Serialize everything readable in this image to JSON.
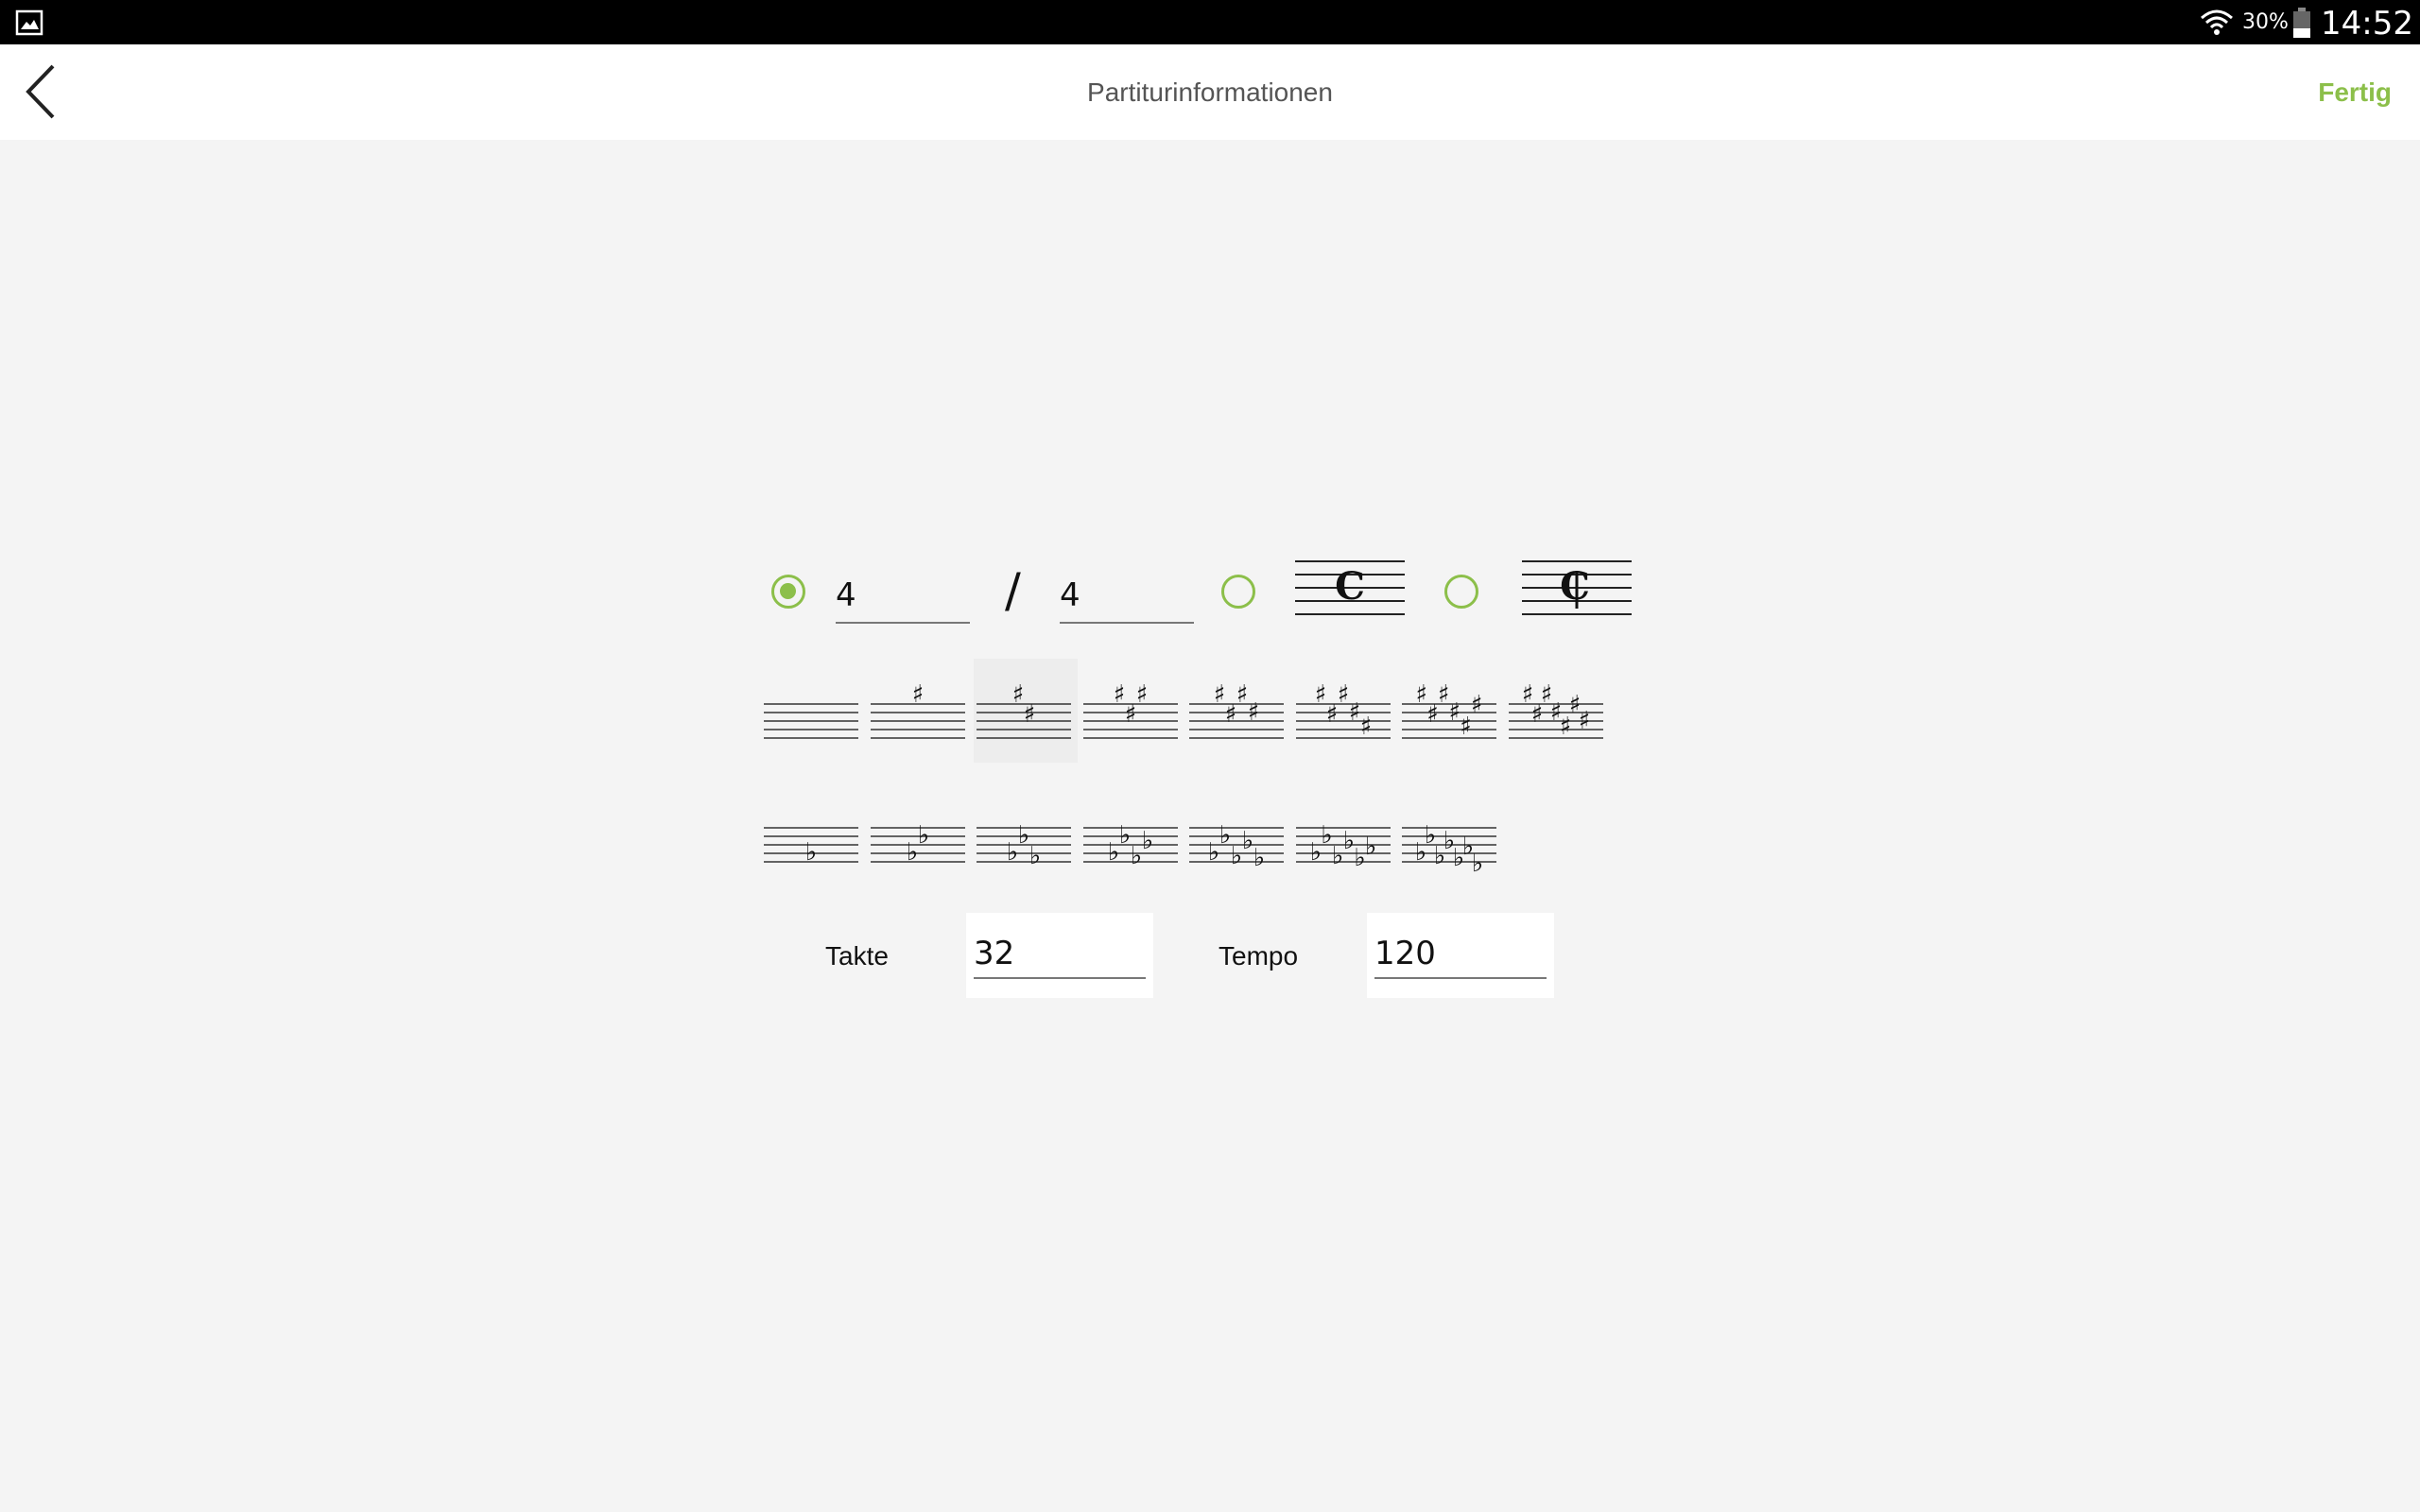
{
  "status_bar": {
    "battery_percent": "30%",
    "time": "14:52",
    "icons": [
      "gallery-icon",
      "wifi-icon",
      "battery-icon"
    ]
  },
  "app_bar": {
    "title": "Partiturinformationen",
    "done_label": "Fertig",
    "back_icon": "chevron-left-icon"
  },
  "time_signature": {
    "selected": "numeric",
    "numerator": "4",
    "denominator": "4",
    "separator": "/",
    "options": [
      "numeric",
      "common-time",
      "cut-time"
    ]
  },
  "key_signatures": {
    "selected_index": 2,
    "sharps": [
      0,
      1,
      2,
      3,
      4,
      5,
      6,
      7
    ],
    "flats": [
      1,
      2,
      3,
      4,
      5,
      6,
      7
    ]
  },
  "score": {
    "measures_label": "Takte",
    "measures_value": "32",
    "tempo_label": "Tempo",
    "tempo_value": "120"
  },
  "colors": {
    "accent": "#8cbf4a",
    "background": "#f4f4f4",
    "app_bar": "#ffffff",
    "status_bar": "#000000"
  }
}
